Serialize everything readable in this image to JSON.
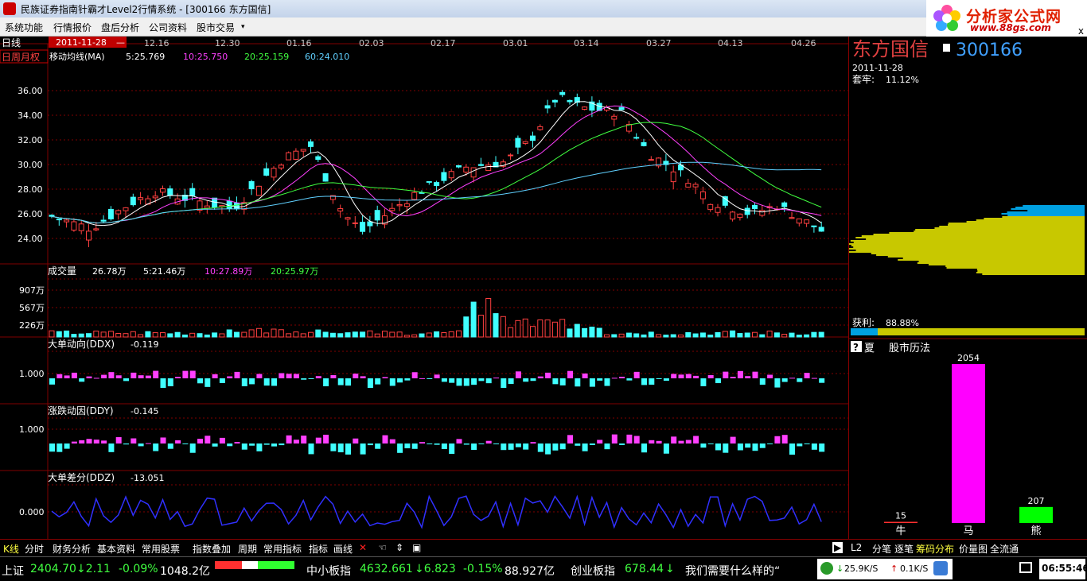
{
  "window": {
    "title": "民族证券指南针霸才Level2行情系统 - [300166 东方国信]"
  },
  "logo": {
    "brand": "分析家公式网",
    "url": "www.88gs.com",
    "close": "x"
  },
  "menu": [
    "系统功能",
    "行情报价",
    "盘后分析",
    "公司资料",
    "股市交易"
  ],
  "chart_header": {
    "period": "日线",
    "cursor_date": "2011-11-28",
    "cursor_dash": "—",
    "period_tabs": "日周月权",
    "dates": [
      "12.16",
      "12.30",
      "01.16",
      "02.03",
      "02.17",
      "03.01",
      "03.14",
      "03.27",
      "04.13",
      "04.26"
    ]
  },
  "ma_legend": {
    "name": "移动均线(MA)",
    "ma5": "5:25.769",
    "ma10": "10:25.750",
    "ma20": "20:25.159",
    "ma60": "60:24.010"
  },
  "price_axis": [
    "36.00",
    "34.00",
    "32.00",
    "30.00",
    "28.00",
    "26.00",
    "24.00"
  ],
  "vol_legend": {
    "name": "成交量",
    "vol": "26.78万",
    "v5": "5:21.46万",
    "v10": "10:27.89万",
    "v20": "20:25.97万"
  },
  "vol_axis": [
    "907万",
    "567万",
    "226万"
  ],
  "ddx": {
    "name": "大单动向(DDX)",
    "value": "-0.119",
    "axis": "1.000"
  },
  "ddy": {
    "name": "涨跌动因(DDY)",
    "value": "-0.145",
    "axis": "1.000"
  },
  "ddz": {
    "name": "大单差分(DDZ)",
    "value": "-13.051",
    "axis": "0.000"
  },
  "right": {
    "stock_name": "东方国信",
    "stock_code": "300166",
    "date": "2011-11-28",
    "trap_label": "套牢:",
    "trap_value": "11.12%",
    "profit_label": "获利:",
    "profit_value": "88.88%",
    "help_icon": "?",
    "summer": "夏",
    "history_title": "股市历法",
    "bars": [
      {
        "label": "牛",
        "value": "15",
        "color": "#ff3030"
      },
      {
        "label": "马",
        "value": "2054",
        "color": "#ff00ff"
      },
      {
        "label": "熊",
        "value": "207",
        "color": "#00ff00"
      }
    ]
  },
  "toolbar": {
    "left": [
      "K线",
      "分时",
      "财务分析",
      "基本资料",
      "常用股票",
      "指数叠加",
      "周期",
      "常用指标",
      "指标",
      "画线"
    ],
    "right": [
      "L2",
      "分笔",
      "逐笔",
      "筹码分布",
      "价量图",
      "全流通"
    ],
    "arrow": "▶"
  },
  "status": {
    "sh_name": "上证",
    "sh_price": "2404.70",
    "sh_change": "↓2.11",
    "sh_pct": "-0.09%",
    "sh_amt": "1048.2亿",
    "zx_name": "中小板指",
    "zx_price": "4632.661",
    "zx_change": "↓6.823",
    "zx_pct": "-0.15%",
    "zx_amt": "88.927亿",
    "cy_name": "创业板指",
    "cy_price": "678.44",
    "cy_change": "↓",
    "news": "我们需要什么样的“",
    "net_down": "25.9K/S",
    "net_up": "0.1K/S",
    "time": "06:55:46"
  }
}
